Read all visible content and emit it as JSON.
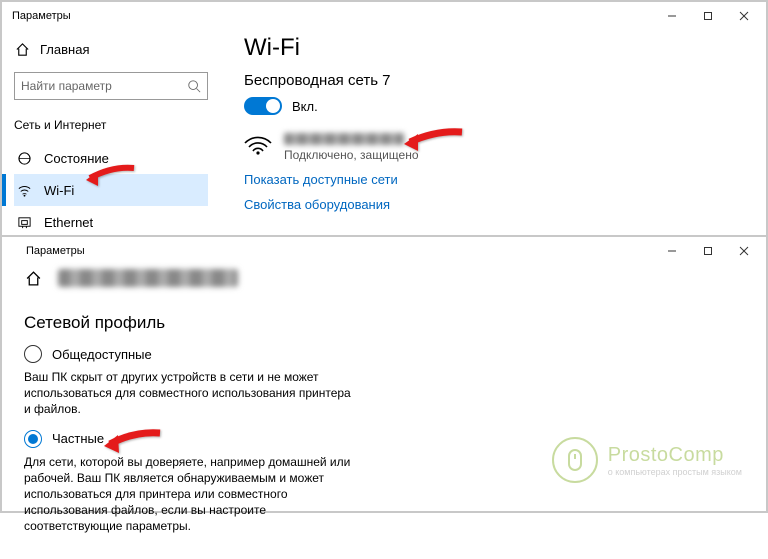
{
  "upper": {
    "title": "Параметры",
    "home": "Главная",
    "search_placeholder": "Найти параметр",
    "category": "Сеть и Интернет",
    "nav": {
      "status": "Состояние",
      "wifi": "Wi-Fi",
      "ethernet": "Ethernet"
    },
    "page": {
      "heading": "Wi-Fi",
      "ssid_heading": "Беспроводная сеть 7",
      "toggle_label": "Вкл.",
      "connected_status": "Подключено, защищено",
      "link_available": "Показать доступные сети",
      "link_hwprops": "Свойства оборудования"
    }
  },
  "lower": {
    "title": "Параметры",
    "section": "Сетевой профиль",
    "public": {
      "label": "Общедоступные",
      "desc": "Ваш ПК скрыт от других устройств в сети и не может использоваться для совместного использования принтера и файлов."
    },
    "private": {
      "label": "Частные",
      "desc": "Для сети, которой вы доверяете, например домашней или рабочей. Ваш ПК является обнаруживаемым и может использоваться для принтера или совместного использования файлов, если вы настроите соответствующие параметры."
    }
  },
  "watermark": {
    "name": "ProstoComp",
    "tag": "о компьютерах простым языком"
  }
}
